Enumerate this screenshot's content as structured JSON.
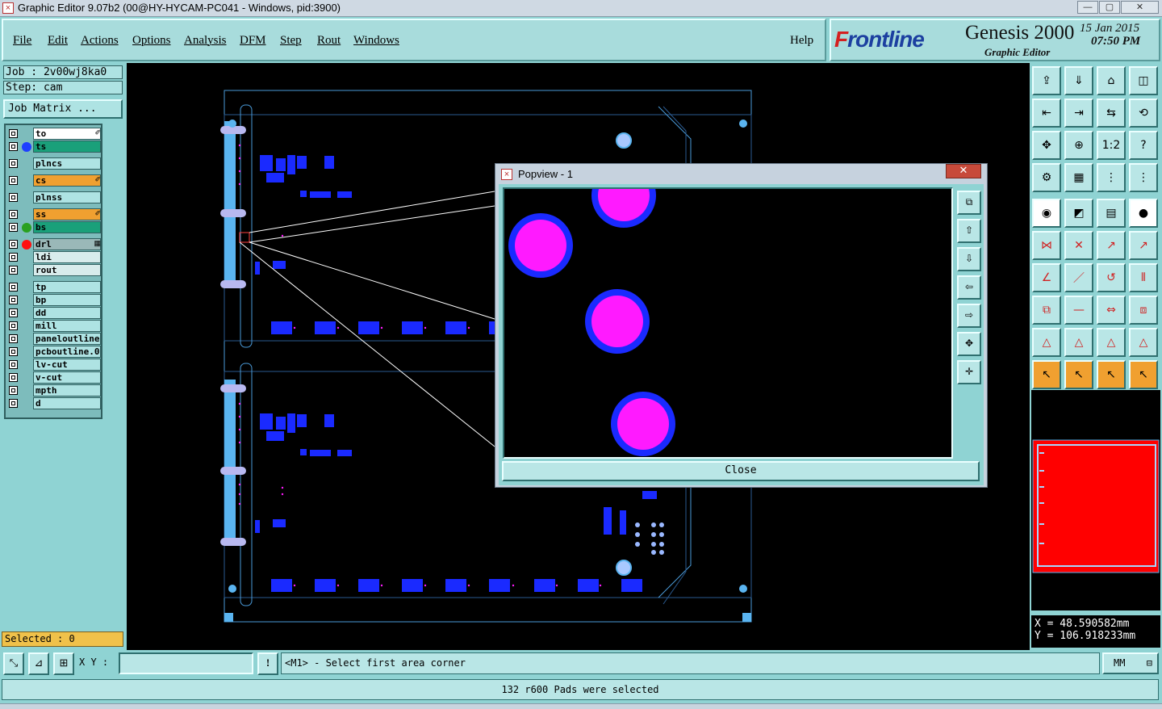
{
  "window": {
    "title": "Graphic Editor 9.07b2 (00@HY-HYCAM-PC041 - Windows, pid:3900)",
    "minimize": "—",
    "maximize": "▢",
    "close": "✕"
  },
  "menu": {
    "items": [
      "File",
      "Edit",
      "Actions",
      "Options",
      "Analysis",
      "DFM",
      "Step",
      "Rout",
      "Windows"
    ],
    "help": "Help"
  },
  "brand": {
    "logo_f": "F",
    "logo_rest": "rontline",
    "product": "Genesis 2000",
    "subtitle": "Graphic Editor",
    "date": "15 Jan 2015",
    "time": "07:50 PM"
  },
  "job": {
    "job_line": "Job : 2v00wj8ka0",
    "step_line": "Step: cam",
    "matrix_button": "Job Matrix ..."
  },
  "layers": [
    {
      "name": "to",
      "bg": "#ffffff",
      "dot": "",
      "mark": "✐"
    },
    {
      "name": "ts",
      "bg": "#1aa07a",
      "dot": "#1f3fff",
      "mark": ""
    },
    {
      "name": "plncs",
      "bg": "#aee3e3",
      "dot": "",
      "mark": ""
    },
    {
      "name": "cs",
      "bg": "#f0a030",
      "dot": "",
      "mark": "✐"
    },
    {
      "name": "plnss",
      "bg": "#aee3e3",
      "dot": "",
      "mark": ""
    },
    {
      "name": "ss",
      "bg": "#f0a030",
      "dot": "",
      "mark": "✐"
    },
    {
      "name": "bs",
      "bg": "#1aa07a",
      "dot": "#2aa020",
      "mark": ""
    },
    {
      "name": "drl",
      "bg": "#9ab8b8",
      "dot": "#ff1010",
      "mark": "▦"
    },
    {
      "name": "ldi",
      "bg": "#d8ecec",
      "dot": "",
      "mark": ""
    },
    {
      "name": "rout",
      "bg": "#d8ecec",
      "dot": "",
      "mark": ""
    },
    {
      "name": "tp",
      "bg": "#aee3e3",
      "dot": "",
      "mark": ""
    },
    {
      "name": "bp",
      "bg": "#aee3e3",
      "dot": "",
      "mark": ""
    },
    {
      "name": "dd",
      "bg": "#aee3e3",
      "dot": "",
      "mark": ""
    },
    {
      "name": "mill",
      "bg": "#aee3e3",
      "dot": "",
      "mark": ""
    },
    {
      "name": "paneloutline",
      "bg": "#aee3e3",
      "dot": "",
      "mark": ""
    },
    {
      "name": "pcboutline.0",
      "bg": "#aee3e3",
      "dot": "",
      "mark": ""
    },
    {
      "name": "lv-cut",
      "bg": "#aee3e3",
      "dot": "",
      "mark": ""
    },
    {
      "name": "v-cut",
      "bg": "#aee3e3",
      "dot": "",
      "mark": ""
    },
    {
      "name": "mpth",
      "bg": "#aee3e3",
      "dot": "",
      "mark": ""
    },
    {
      "name": "d",
      "bg": "#aee3e3",
      "dot": "",
      "mark": ""
    }
  ],
  "selected": "Selected : 0",
  "popview": {
    "title": "Popview - 1",
    "close_icon": "✕",
    "close_button": "Close"
  },
  "coords": {
    "x": "X = 48.590582mm",
    "y": "Y = 106.918233mm"
  },
  "bottom": {
    "xy_label": "X Y :",
    "xy_value": "",
    "prompt": "<M1> - Select first area corner",
    "units": "MM",
    "status": "132 r600 Pads were selected",
    "warn_icon": "!"
  },
  "colors": {
    "panel": "#8fd3d3",
    "pad_fill": "#ff1aff",
    "pad_ring": "#1a2aff",
    "board_outline": "#5aa8e0",
    "minimap_fill": "#ff0000"
  }
}
